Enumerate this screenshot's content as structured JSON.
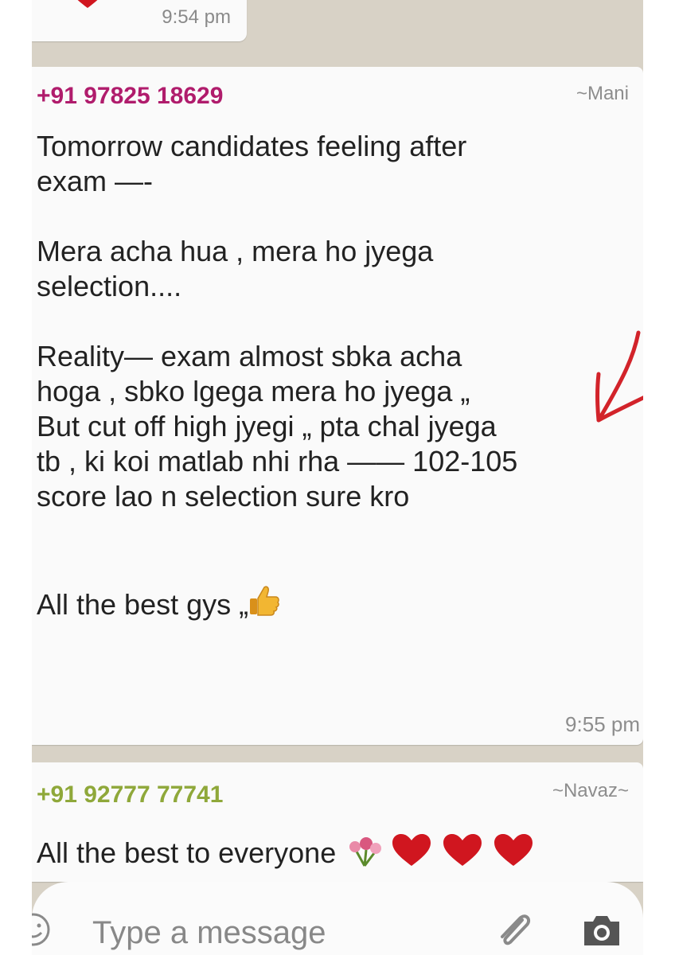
{
  "previous_message": {
    "time": "9:54 pm"
  },
  "message_1": {
    "sender_number": "+91 97825 18629",
    "sender_color": "#b01c6c",
    "sender_alias": "~Mani",
    "body": "Tomorrow candidates feeling after\nexam —-\n\nMera acha hua , mera ho jyega\nselection....\n\nReality— exam almost sbka acha\nhoga , sbko lgega mera ho jyega „\nBut cut off high jyegi „ pta chal jyega\ntb , ki koi matlab nhi rha —— 102-105\nscore lao n selection sure kro\n\n\n",
    "closing_line": "All the best gys „",
    "closing_emoji": "thumbs-up",
    "time": "9:55 pm"
  },
  "message_2": {
    "sender_number": "+91 92777 77741",
    "sender_color": "#8fa83a",
    "sender_alias": "~Navaz~",
    "body": "All the best to everyone",
    "emojis": [
      "flower-bouquet",
      "heart",
      "heart",
      "heart"
    ]
  },
  "composer": {
    "placeholder": "Type a message",
    "icons": [
      "smiley-icon",
      "paperclip-icon",
      "camera-icon"
    ]
  },
  "annotation": {
    "color": "#d2232a",
    "shape": "arrow"
  }
}
